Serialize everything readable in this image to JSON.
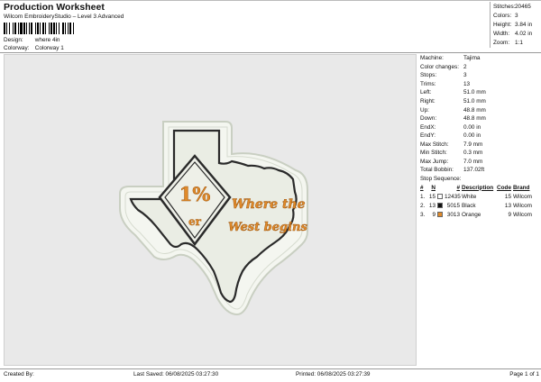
{
  "header": {
    "title": "Production Worksheet",
    "subtitle": "Wilcom EmbroideryStudio – Level 3 Advanced"
  },
  "design": {
    "design_label": "Design:",
    "design_value": "where 4in",
    "colorway_label": "Colorway:",
    "colorway_value": "Colorway 1"
  },
  "summary": {
    "stitches_label": "Stitches:",
    "stitches": "20465",
    "colors_label": "Colors:",
    "colors": "3",
    "height_label": "Height:",
    "height": "3.84 in",
    "width_label": "Width:",
    "width": "4.02 in",
    "zoom_label": "Zoom:",
    "zoom": "1:1"
  },
  "machine_info": {
    "machine_label": "Machine:",
    "machine": "Tajima",
    "color_changes_label": "Color changes:",
    "color_changes": "2",
    "stops_label": "Stops:",
    "stops": "3",
    "trims_label": "Trims:",
    "trims": "13",
    "left_label": "Left:",
    "left": "51.0 mm",
    "right_label": "Right:",
    "right": "51.0 mm",
    "up_label": "Up:",
    "up": "48.8 mm",
    "down_label": "Down:",
    "down": "48.8 mm",
    "endx_label": "EndX:",
    "endx": "0.00 in",
    "endy_label": "EndY:",
    "endy": "0.00 in",
    "max_stitch_label": "Max Stitch:",
    "max_stitch": "7.9 mm",
    "min_stitch_label": "Min Stitch:",
    "min_stitch": "0.3 mm",
    "max_jump_label": "Max Jump:",
    "max_jump": "7.0 mm",
    "total_bobbin_label": "Total Bobbin:",
    "total_bobbin": "137.02ft"
  },
  "stop_sequence": {
    "label": "Stop Sequence:",
    "headers": {
      "num": "#",
      "n": "N",
      "color": "#",
      "description": "Description",
      "code": "Code",
      "brand": "Brand"
    },
    "rows": [
      {
        "idx": "1.",
        "n": "15",
        "swatch": "#ffffff",
        "color": "12435",
        "description": "White",
        "code": "15",
        "brand": "Wilcom"
      },
      {
        "idx": "2.",
        "n": "13",
        "swatch": "#111111",
        "color": "5015",
        "description": "Black",
        "code": "13",
        "brand": "Wilcom"
      },
      {
        "idx": "3.",
        "n": "9",
        "swatch": "#e08a2a",
        "color": "3013",
        "description": "Orange",
        "code": "9",
        "brand": "Wilcom"
      }
    ]
  },
  "design_art": {
    "big_text": "1%",
    "small_text": "er",
    "slogan_line1": "Where the",
    "slogan_line2": "West begins"
  },
  "colors": {
    "orange": "#e08a2a",
    "outline": "#2a2a2a",
    "fill": "#eef0e8",
    "patch": "#f3f5ee"
  },
  "footer": {
    "created_by": "Created By:",
    "last_saved": "Last Saved: 06/08/2025 03:27:30",
    "printed": "Printed: 06/08/2025 03:27:39",
    "page": "Page 1 of 1"
  }
}
